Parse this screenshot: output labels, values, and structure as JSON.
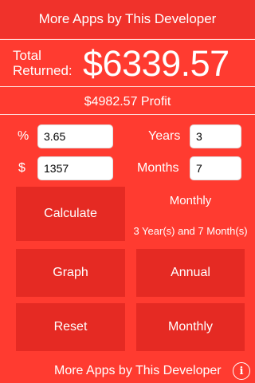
{
  "header": {
    "title": "More Apps by This Developer"
  },
  "summary": {
    "total_label_line1": "Total",
    "total_label_line2": "Returned:",
    "total_value": "$6339.57",
    "profit": "$4982.57 Profit"
  },
  "inputs": {
    "rate_label": "%",
    "rate_value": "3.65",
    "principal_label": "$",
    "principal_value": "1357",
    "years_label": "Years",
    "years_value": "3",
    "months_label": "Months",
    "months_value": "7"
  },
  "status": {
    "compounding": "Monthly",
    "duration": "3 Year(s) and 7 Month(s)"
  },
  "buttons": {
    "calculate": "Calculate",
    "graph": "Graph",
    "annual": "Annual",
    "reset": "Reset",
    "monthly": "Monthly"
  },
  "footer": {
    "more_apps": "More Apps by This Developer",
    "info_icon": "info-icon"
  }
}
